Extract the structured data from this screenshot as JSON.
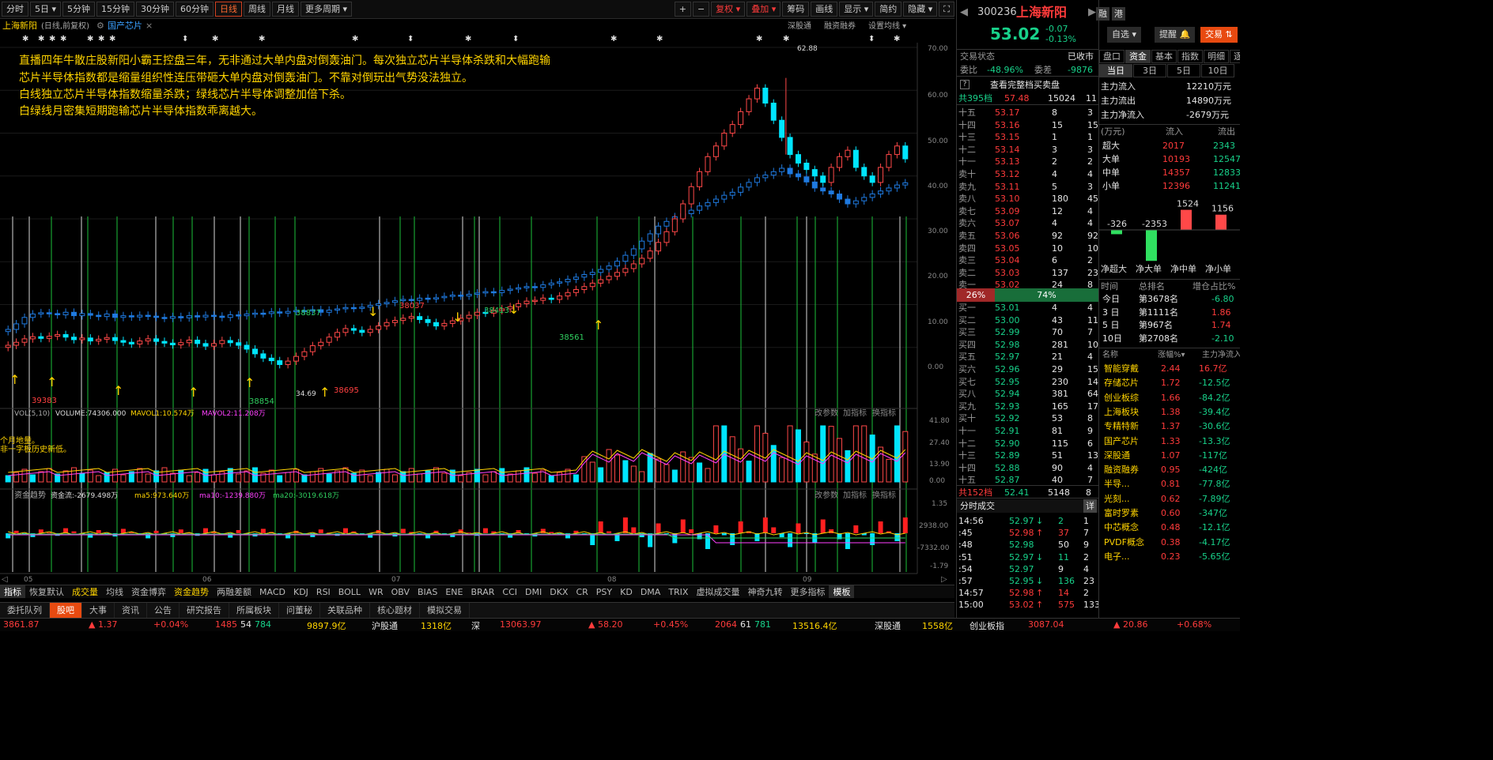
{
  "toolbar": {
    "left": [
      "分时",
      "5日 ▾",
      "5分钟",
      "15分钟",
      "30分钟",
      "60分钟",
      "日线",
      "周线",
      "月线",
      "更多周期 ▾"
    ],
    "active": "日线",
    "right": [
      "+",
      "−",
      "复权 ▾",
      "叠加 ▾",
      "筹码",
      "画线",
      "显示 ▾",
      "简约",
      "隐藏 ▾",
      "⛶"
    ]
  },
  "chart_title": {
    "name": "上海新阳",
    "mode": "(日线,前复权)",
    "sector": "国产芯片",
    "right": [
      "深股通",
      "融资融券",
      "设置均线 ▾"
    ]
  },
  "annotation": [
    "直播四年牛散庄股新阳小霸王控盘三年，无非通过大单内盘对倒轰油门。每次独立芯片半导体杀跌和大幅跑输",
    "芯片半导体指数都是缩量组织性连压带砸大单内盘对倒轰油门。不靠对倒玩出气势没法独立。",
    "白线独立芯片半导体指数缩量杀跌；绿线芯片半导体调整加倍下杀。",
    "白绿线月密集短期跑输芯片半导体指数乖离越大。"
  ],
  "price_axis": [
    "70.00",
    "60.00",
    "50.00",
    "40.00",
    "30.00",
    "20.00",
    "10.00",
    "0.00"
  ],
  "chart_data": [
    {
      "type": "candlestick",
      "title": "上海新阳 (日线,前复权)",
      "x_ticks": [
        "05",
        "06",
        "07",
        "08",
        "09"
      ],
      "ylim": [
        -10,
        70
      ],
      "labels": [
        {
          "text": "62.88"
        },
        {
          "text": "34.69"
        },
        {
          "text": "38837"
        },
        {
          "text": "38037"
        },
        {
          "text": "38413"
        },
        {
          "text": "38561"
        },
        {
          "text": "38695"
        },
        {
          "text": "38854"
        },
        {
          "text": "39383"
        }
      ],
      "series": [
        {
          "color": "#1f7ae0",
          "close": [
            4.2,
            5.5,
            7.0,
            7.8,
            8.1,
            7.9,
            7.6,
            8.2,
            7.4,
            7.9,
            7.5,
            7.2,
            7.8,
            7.0,
            7.4,
            7.1,
            7.5,
            7.3,
            7.0,
            6.8,
            7.2,
            6.9,
            7.4,
            7.1,
            7.5,
            7.3,
            7.0,
            7.6,
            7.4,
            7.8,
            8.0,
            7.9,
            8.3,
            8.0,
            8.4,
            8.6,
            8.5,
            8.8,
            8.2,
            8.7,
            9.0,
            9.3,
            9.1,
            9.4,
            9.8,
            10.2,
            10.5,
            10.9,
            11.2,
            11.0,
            11.5,
            11.3,
            11.6,
            11.9,
            12.2,
            12.0,
            12.4,
            12.7,
            13.0,
            12.8,
            13.3,
            13.6,
            13.9,
            14.2,
            14.0,
            14.6,
            15.0,
            15.3,
            15.9,
            16.4,
            17.0,
            17.5,
            18.2,
            19.0,
            20.1,
            21.5,
            23.0,
            24.8,
            26.5,
            28.3,
            29.4,
            30.5,
            31.2,
            32.0,
            33.0,
            33.8,
            34.6,
            35.5,
            36.2,
            37.4,
            38.5,
            39.6,
            40.2,
            41.0,
            41.8,
            40.5,
            39.8,
            38.6,
            37.2,
            36.5,
            35.8,
            34.6,
            33.5,
            34.2,
            35.0,
            35.8,
            36.5,
            37.2,
            37.9,
            38.4
          ]
        },
        {
          "color": "#e04040",
          "close": [
            0.5,
            1.2,
            2.0,
            2.5,
            2.1,
            2.6,
            3.0,
            2.4,
            1.8,
            2.2,
            1.5,
            1.9,
            2.3,
            1.6,
            1.2,
            0.8,
            1.5,
            2.0,
            1.4,
            1.0,
            0.6,
            1.1,
            1.7,
            0.9,
            0.3,
            0.9,
            1.6,
            1.1,
            0.5,
            -0.4,
            -1.5,
            -2.5,
            -3.1,
            -4.0,
            -3.2,
            -2.1,
            -1.0,
            0.4,
            1.2,
            2.4,
            3.5,
            4.4,
            4.0,
            3.5,
            4.2,
            5.0,
            5.8,
            6.3,
            6.8,
            7.2,
            6.5,
            5.8,
            5.0,
            5.6,
            6.2,
            6.8,
            7.5,
            8.2,
            8.0,
            8.6,
            9.0,
            9.5,
            10.2,
            10.8,
            11.0,
            11.5,
            11.2,
            12.0,
            12.8,
            13.5,
            14.2,
            15.0,
            15.8,
            16.6,
            17.5,
            18.4,
            19.5,
            20.8,
            22.5,
            24.5,
            27.0,
            30.0,
            33.5,
            37.5,
            41.0,
            44.5,
            47.0,
            50.0,
            52.0,
            55.0,
            58.0,
            60.5,
            57.0,
            53.0,
            49.0,
            45.0,
            43.0,
            41.5,
            40.0,
            38.5,
            42.0,
            44.5,
            46.0,
            42.0,
            40.0,
            38.5,
            42.0,
            45.0,
            47.0,
            44.0
          ]
        }
      ]
    },
    {
      "type": "bar",
      "title": "VOL(5,10)",
      "legend": [
        "VOLUME:74306.000",
        "MAVOL1:10.574万",
        "MAVOL2:11.208万"
      ],
      "yticks": [
        "41.80",
        "27.40",
        "13.90",
        "0.00"
      ],
      "note": [
        "个月地量。",
        "非一字板历史新低。"
      ],
      "buttons": [
        "改参数",
        "加指标",
        "换指标"
      ]
    },
    {
      "type": "bar",
      "title": "资金趋势",
      "legend": [
        "资金流:-2679.498万",
        "ma5:973.640万",
        "ma10:-1239.880万",
        "ma20:-3019.618万"
      ],
      "yticks": [
        "1.35",
        "2938.00",
        "-7332.00",
        "-1.79"
      ],
      "buttons": [
        "改参数",
        "加指标",
        "换指标"
      ]
    }
  ],
  "indicator_tabs": [
    "指标",
    "恢复默认",
    "成交量",
    "均线",
    "资金博弈",
    "资金趋势",
    "两融差额",
    "MACD",
    "KDJ",
    "RSI",
    "BOLL",
    "WR",
    "OBV",
    "BIAS",
    "ENE",
    "BRAR",
    "CCI",
    "DMI",
    "DKX",
    "CR",
    "PSY",
    "KD",
    "DMA",
    "TRIX",
    "虚拟成交量",
    "神奇九转",
    "更多指标",
    "模板"
  ],
  "bottom_tabs": [
    "委托队列",
    "股吧",
    "大事",
    "资讯",
    "公告",
    "研究报告",
    "所属板块",
    "问董秘",
    "关联品种",
    "核心题材",
    "模拟交易"
  ],
  "bottom_active": "股吧",
  "quote": {
    "code": "300236",
    "name": "上海新阳",
    "price": "53.02",
    "change": "-0.07",
    "pct": "-0.13%",
    "badge1": "融",
    "badge2": "港",
    "btn_watch": "自选 ▾",
    "btn_alert": "提醒 🔔",
    "btn_trade": "交易 ⇅",
    "state_label": "交易状态",
    "state": "已收市",
    "wb_label": "委比",
    "wb": "-48.96%",
    "wc_label": "委差",
    "wc": "-9876",
    "full_btn": "查看完整档买卖盘",
    "sell_total": {
      "label": "共395档",
      "price": "57.48",
      "vol": "15024",
      "n": "11"
    },
    "buy_total": {
      "label": "共152档",
      "price": "52.41",
      "vol": "5148",
      "n": "8"
    },
    "ratio_sell": "26%",
    "ratio_buy": "74%",
    "sells": [
      [
        "十五",
        "53.17",
        "8",
        "3"
      ],
      [
        "十四",
        "53.16",
        "15",
        "15"
      ],
      [
        "十三",
        "53.15",
        "1",
        "1"
      ],
      [
        "十二",
        "53.14",
        "3",
        "3"
      ],
      [
        "十一",
        "53.13",
        "2",
        "2"
      ],
      [
        "卖十",
        "53.12",
        "4",
        "4"
      ],
      [
        "卖九",
        "53.11",
        "5",
        "3"
      ],
      [
        "卖八",
        "53.10",
        "180",
        "45"
      ],
      [
        "卖七",
        "53.09",
        "12",
        "4"
      ],
      [
        "卖六",
        "53.07",
        "4",
        "4"
      ],
      [
        "卖五",
        "53.06",
        "92",
        "92"
      ],
      [
        "卖四",
        "53.05",
        "10",
        "10"
      ],
      [
        "卖三",
        "53.04",
        "6",
        "2"
      ],
      [
        "卖二",
        "53.03",
        "137",
        "23"
      ],
      [
        "卖一",
        "53.02",
        "24",
        "8"
      ]
    ],
    "buys": [
      [
        "买一",
        "53.01",
        "4",
        "4"
      ],
      [
        "买二",
        "53.00",
        "43",
        "11"
      ],
      [
        "买三",
        "52.99",
        "70",
        "7"
      ],
      [
        "买四",
        "52.98",
        "281",
        "10"
      ],
      [
        "买五",
        "52.97",
        "21",
        "4"
      ],
      [
        "买六",
        "52.96",
        "29",
        "15"
      ],
      [
        "买七",
        "52.95",
        "230",
        "14"
      ],
      [
        "买八",
        "52.94",
        "381",
        "64"
      ],
      [
        "买九",
        "52.93",
        "165",
        "17"
      ],
      [
        "买十",
        "52.92",
        "53",
        "8"
      ],
      [
        "十一",
        "52.91",
        "81",
        "9"
      ],
      [
        "十二",
        "52.90",
        "115",
        "6"
      ],
      [
        "十三",
        "52.89",
        "51",
        "13"
      ],
      [
        "十四",
        "52.88",
        "90",
        "4"
      ],
      [
        "十五",
        "52.87",
        "40",
        "7"
      ]
    ],
    "ticks_title": "分时成交",
    "ticks_btn": "详",
    "ticks": [
      [
        "14:56",
        "52.97",
        "↓",
        "2",
        "1"
      ],
      [
        ":45",
        "52.98",
        "↑",
        "37",
        "7"
      ],
      [
        ":48",
        "52.98",
        "",
        "50",
        "9"
      ],
      [
        ":51",
        "52.97",
        "↓",
        "11",
        "2"
      ],
      [
        ":54",
        "52.97",
        "",
        "9",
        "4"
      ],
      [
        ":57",
        "52.95",
        "↓",
        "136",
        "23"
      ],
      [
        "14:57",
        "52.98",
        "↑",
        "14",
        "2"
      ],
      [
        "15:00",
        "53.02",
        "↑",
        "575",
        "133"
      ]
    ]
  },
  "fund": {
    "tabs": [
      "盘口",
      "资金",
      "基本",
      "指数",
      "明细",
      "逐笔"
    ],
    "active": "资金",
    "periods": [
      "当日",
      "3日",
      "5日",
      "10日"
    ],
    "main": [
      [
        "主力流入",
        "12210万元"
      ],
      [
        "主力流出",
        "14890万元"
      ],
      [
        "主力净流入",
        "-2679万元"
      ]
    ],
    "flow_head": [
      "(万元)",
      "流入",
      "流出"
    ],
    "flow": [
      [
        "超大",
        "2017",
        "2343"
      ],
      [
        "大单",
        "10193",
        "12547"
      ],
      [
        "中单",
        "14357",
        "12833"
      ],
      [
        "小单",
        "12396",
        "11241"
      ]
    ],
    "net_chart": {
      "type": "bar",
      "categories": [
        "净超大",
        "净大单",
        "净中单",
        "净小单"
      ],
      "values": [
        -326,
        -2353,
        1524,
        1156
      ]
    },
    "rank_head": [
      "时间",
      "总排名",
      "增仓占比%"
    ],
    "rank": [
      [
        "今日",
        "第3678名",
        "-6.80"
      ],
      [
        "3 日",
        "第1111名",
        "1.86"
      ],
      [
        "5 日",
        "第967名",
        "1.74"
      ],
      [
        "10日",
        "第2708名",
        "-2.10"
      ]
    ],
    "sector_head": [
      "名称",
      "涨幅%▾",
      "主力净流入"
    ],
    "sectors": [
      [
        "智能穿戴",
        "2.44",
        "16.7亿"
      ],
      [
        "存储芯片",
        "1.72",
        "-12.5亿"
      ],
      [
        "创业板综",
        "1.66",
        "-84.2亿"
      ],
      [
        "上海板块",
        "1.38",
        "-39.4亿"
      ],
      [
        "专精特新",
        "1.37",
        "-30.6亿"
      ],
      [
        "国产芯片",
        "1.33",
        "-13.3亿"
      ],
      [
        "深股通",
        "1.07",
        "-117亿"
      ],
      [
        "融资融券",
        "0.95",
        "-424亿"
      ],
      [
        "半导...",
        "0.81",
        "-77.8亿"
      ],
      [
        "光刻...",
        "0.62",
        "-7.89亿"
      ],
      [
        "富时罗素",
        "0.60",
        "-347亿"
      ],
      [
        "中芯概念",
        "0.48",
        "-12.1亿"
      ],
      [
        "PVDF概念",
        "0.38",
        "-4.17亿"
      ],
      [
        "电子...",
        "0.23",
        "-5.65亿"
      ]
    ]
  },
  "statusbar": {
    "sh": "3861.87",
    "sh_chg": "▲ 1.37",
    "sh_pct": "+0.04%",
    "sh_up": "1485",
    "sh_flat": "54",
    "sh_dn": "784",
    "sh_amt": "9897.9亿",
    "hgt": "沪股通",
    "hgt_val": "1318亿",
    "sz": "深",
    "sz_idx": "13063.97",
    "sz_chg": "▲ 58.20",
    "sz_pct": "+0.45%",
    "sz_up": "2064",
    "sz_flat": "61",
    "sz_dn": "781",
    "sz_amt": "13516.4亿",
    "sgt": "深股通",
    "sgt_val": "1558亿",
    "cyb": "创业板指",
    "cyb_idx": "3087.04",
    "cyb_chg": "▲ 20.86",
    "cyb_pct": "+0.68%"
  }
}
